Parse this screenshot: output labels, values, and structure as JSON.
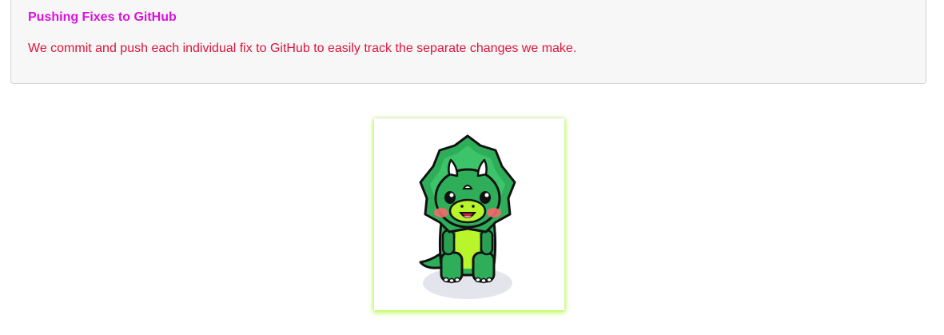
{
  "card": {
    "title": "Pushing Fixes to GitHub",
    "body": "We commit and push each individual fix to GitHub to easily track the separate changes we make."
  },
  "image": {
    "subject": "dinosaur-illustration",
    "colors": {
      "title": "#dd10dd",
      "body": "#dc143c",
      "frame_glow": "#adff2f",
      "dino_green": "#2fae5a",
      "dino_belly": "#b8f52a"
    }
  }
}
